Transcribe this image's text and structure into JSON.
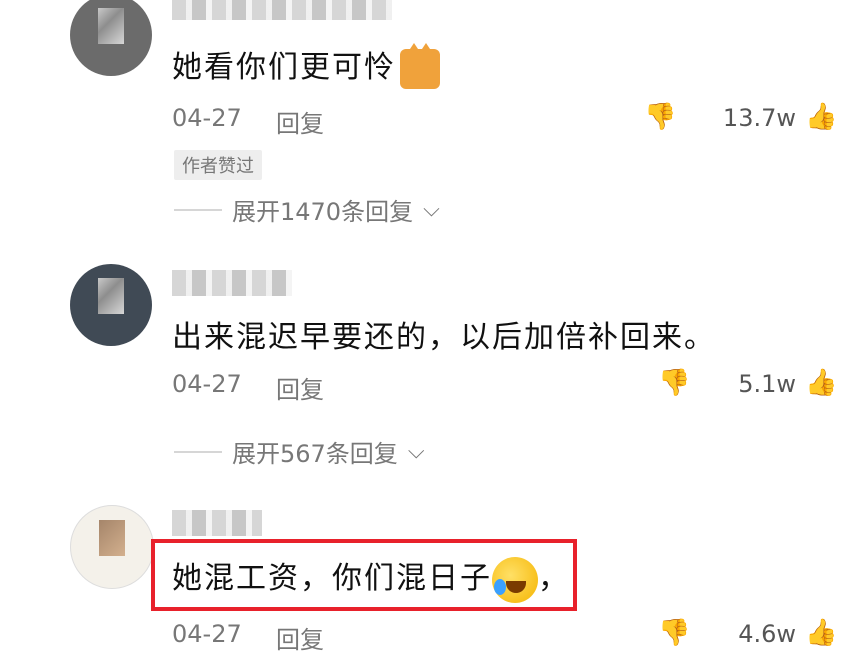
{
  "comments": [
    {
      "text": "她看你们更可怜",
      "emoji": "cat-face-icon",
      "date": "04-27",
      "reply_label": "回复",
      "likes": "13.7w",
      "badge": "作者赞过",
      "expand_label": "展开1470条回复"
    },
    {
      "text": "出来混迟早要还的，以后加倍补回来。",
      "date": "04-27",
      "reply_label": "回复",
      "likes": "5.1w",
      "expand_label": "展开567条回复"
    },
    {
      "text": "她混工资，你们混日子",
      "emoji": "rolling-laughing-face-icon",
      "text_suffix": "，",
      "date": "04-27",
      "reply_label": "回复",
      "likes": "4.6w"
    }
  ],
  "colors": {
    "highlight": "#e8212b",
    "secondary_text": "#777777",
    "icon_gray": "#b6b6b6"
  }
}
